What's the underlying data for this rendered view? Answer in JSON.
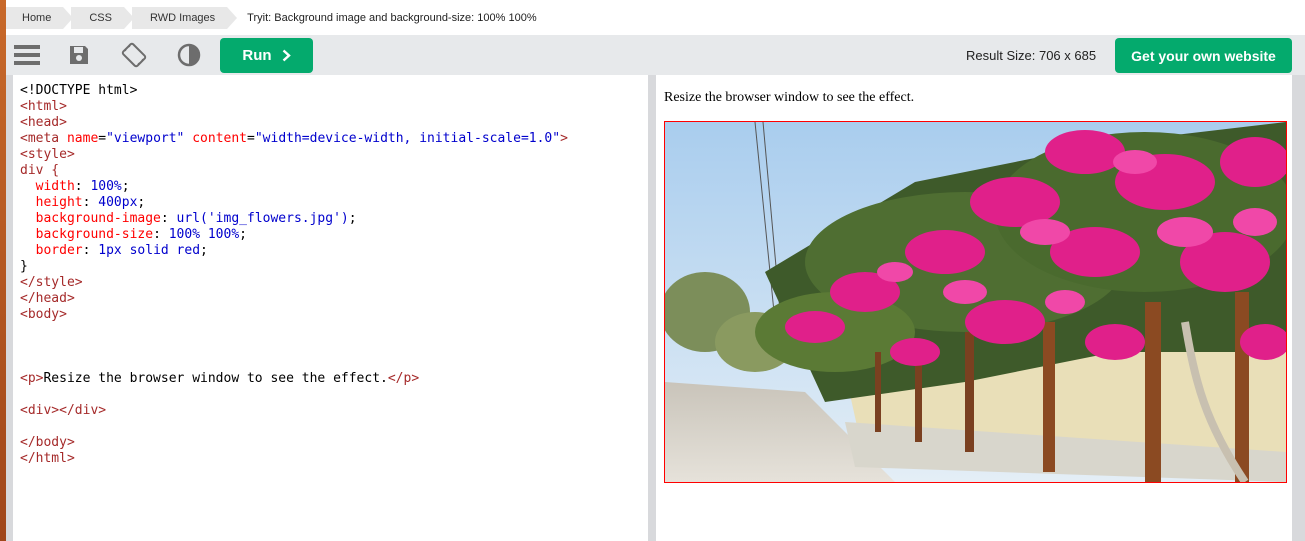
{
  "breadcrumb": {
    "items": [
      "Home",
      "CSS",
      "RWD Images"
    ],
    "current": "Tryit: Background image and background-size: 100% 100%"
  },
  "toolbar": {
    "icons": [
      "menu-icon",
      "save-icon",
      "rotate-icon",
      "contrast-icon"
    ],
    "run_label": "Run",
    "result_size_label": "Result Size: 706 x 685",
    "get_website_label": "Get your own website"
  },
  "code": {
    "l1": "<!DOCTYPE html>",
    "l2_tag": "<html>",
    "l3_tag": "<head>",
    "l4_open": "<meta",
    "l4_attr1": "name",
    "l4_val1": "\"viewport\"",
    "l4_attr2": "content",
    "l4_val2": "\"width=device-width, initial-scale=1.0\"",
    "l4_close": ">",
    "l5_tag": "<style>",
    "l6_sel": "div {",
    "l7_prop": "width",
    "l7_val": "100%",
    "l8_prop": "height",
    "l8_val": "400px",
    "l9_prop": "background-image",
    "l9_val": "url('img_flowers.jpg')",
    "l10_prop": "background-size",
    "l10_val": "100% 100%",
    "l11_prop": "border",
    "l11_val": "1px solid red",
    "l12": "}",
    "l13_tag": "</style>",
    "l14_tag": "</head>",
    "l15_tag": "<body>",
    "l19_open": "<p>",
    "l19_text": "Resize the browser window to see the effect.",
    "l19_close": "</p>",
    "l21_tag": "<div></div>",
    "l23_tag": "</body>",
    "l24_tag": "</html>"
  },
  "result": {
    "text": "Resize the browser window to see the effect."
  },
  "colors": {
    "accent": "#04aa6d",
    "tag": "#a52a2a",
    "attr": "#ff0000",
    "value": "#0000cd",
    "border_red": "#ff0000"
  }
}
